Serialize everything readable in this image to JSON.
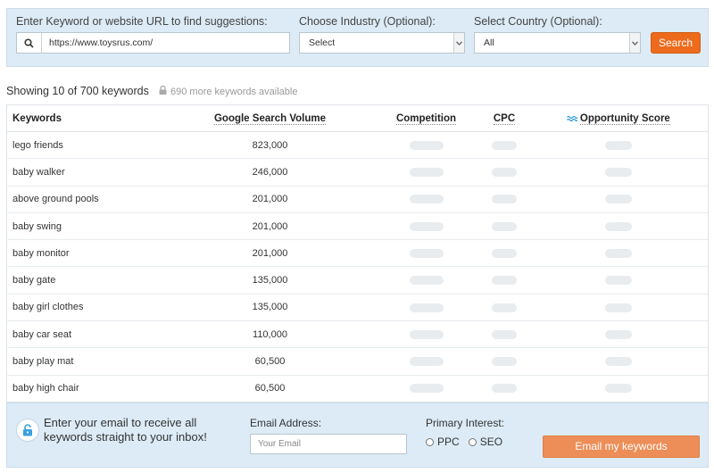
{
  "search": {
    "keyword_label": "Enter Keyword or website URL to find suggestions:",
    "keyword_value": "https://www.toysrus.com/",
    "industry_label": "Choose Industry (Optional):",
    "industry_value": "Select",
    "country_label": "Select Country (Optional):",
    "country_value": "All",
    "button_label": "Search",
    "accent_color": "#ec6b1d"
  },
  "summary": {
    "showing": "Showing 10 of 700 keywords",
    "more": "690 more keywords available"
  },
  "table": {
    "headers": {
      "keyword": "Keywords",
      "volume": "Google Search Volume",
      "competition": "Competition",
      "cpc": "CPC",
      "opportunity": "Opportunity Score"
    },
    "rows": [
      {
        "keyword": "lego friends",
        "volume": "823,000"
      },
      {
        "keyword": "baby walker",
        "volume": "246,000"
      },
      {
        "keyword": "above ground pools",
        "volume": "201,000"
      },
      {
        "keyword": "baby swing",
        "volume": "201,000"
      },
      {
        "keyword": "baby monitor",
        "volume": "201,000"
      },
      {
        "keyword": "baby gate",
        "volume": "135,000"
      },
      {
        "keyword": "baby girl clothes",
        "volume": "135,000"
      },
      {
        "keyword": "baby car seat",
        "volume": "110,000"
      },
      {
        "keyword": "baby play mat",
        "volume": "60,500"
      },
      {
        "keyword": "baby high chair",
        "volume": "60,500"
      }
    ]
  },
  "email": {
    "prompt": "Enter your email to receive all keywords straight to your inbox!",
    "address_label": "Email Address:",
    "address_placeholder": "Your Email",
    "interest_label": "Primary Interest:",
    "option_ppc": "PPC",
    "option_seo": "SEO",
    "button_label": "Email my keywords",
    "button_color": "#ed8e58"
  }
}
